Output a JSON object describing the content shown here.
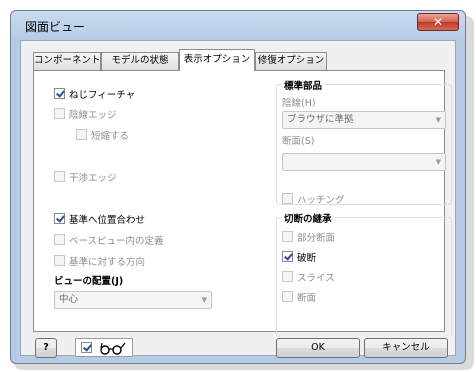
{
  "window": {
    "title": "図面ビュー",
    "close_label": "✕"
  },
  "tabs": [
    {
      "label": "コンポーネント",
      "active": false
    },
    {
      "label": "モデルの状態",
      "active": false
    },
    {
      "label": "表示オプション",
      "active": true
    },
    {
      "label": "修復オプション",
      "active": false
    }
  ],
  "options": {
    "thread_feature": {
      "label": "ねじフィーチャ",
      "checked": true,
      "enabled": true
    },
    "hidden_edges": {
      "label": "陰線エッジ",
      "checked": false,
      "enabled": false
    },
    "foreshortened": {
      "label": "短縮する",
      "checked": false,
      "enabled": false
    },
    "interference_edges": {
      "label": "干渉エッジ",
      "checked": false,
      "enabled": false
    },
    "align_to_base": {
      "label": "基準へ位置合わせ",
      "checked": true,
      "enabled": true
    },
    "define_in_base_view": {
      "label": "ベースビュー内の定義",
      "checked": false,
      "enabled": false
    },
    "orientation_to_base": {
      "label": "基準に対する方向",
      "checked": false,
      "enabled": false
    }
  },
  "view_justification": {
    "label": "ビューの配置(J)",
    "value": "中心"
  },
  "standard_parts": {
    "title": "標準部品",
    "hidden_line_label": "陰線(H)",
    "hidden_line_value": "ブラウザに準拠",
    "section_label": "断面(S)",
    "section_value": ""
  },
  "hatching": {
    "label": "ハッチング",
    "checked": false,
    "enabled": false
  },
  "cut_inheritance": {
    "title": "切断の継承",
    "items": [
      {
        "label": "部分断面",
        "checked": false,
        "enabled": false
      },
      {
        "label": "破断",
        "checked": true,
        "enabled": true
      },
      {
        "label": "スライス",
        "checked": false,
        "enabled": false
      },
      {
        "label": "断面",
        "checked": false,
        "enabled": false
      }
    ]
  },
  "footer": {
    "help_label": "?",
    "preview_checked": true,
    "ok_label": "OK",
    "cancel_label": "キャンセル"
  }
}
